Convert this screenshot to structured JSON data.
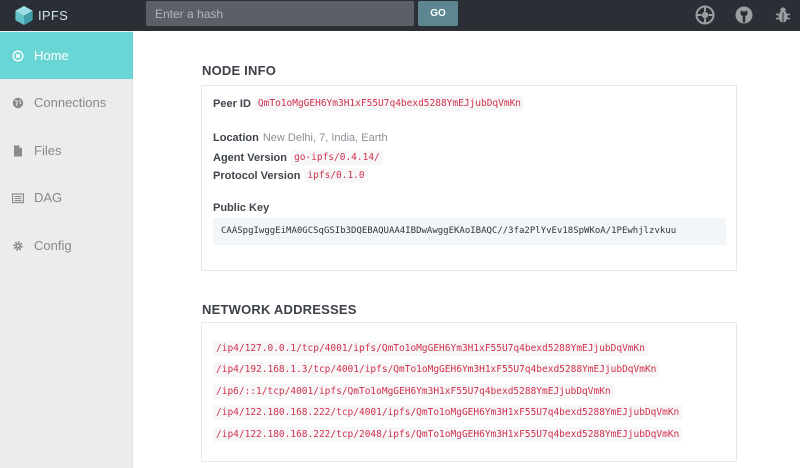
{
  "app": {
    "name": "IPFS"
  },
  "search": {
    "placeholder": "Enter a hash",
    "go_label": "GO"
  },
  "topbar_icons": [
    "settings-wheel-icon",
    "github-icon",
    "bug-icon"
  ],
  "sidebar": {
    "items": [
      {
        "label": "Home",
        "icon": "home-target-icon",
        "active": true
      },
      {
        "label": "Connections",
        "icon": "globe-icon",
        "active": false
      },
      {
        "label": "Files",
        "icon": "file-icon",
        "active": false
      },
      {
        "label": "DAG",
        "icon": "dag-list-icon",
        "active": false
      },
      {
        "label": "Config",
        "icon": "gear-icon",
        "active": false
      }
    ]
  },
  "node_info": {
    "title": "NODE INFO",
    "peer_id_label": "Peer ID",
    "peer_id": "QmTo1oMgGEH6Ym3H1xF55U7q4bexd5288YmEJjubDqVmKn",
    "location_label": "Location",
    "location": "New Delhi, 7, India, Earth",
    "agent_label": "Agent Version",
    "agent": "go-ipfs/0.4.14/",
    "protocol_label": "Protocol Version",
    "protocol": "ipfs/0.1.0",
    "public_key_label": "Public Key",
    "public_key": "CAASpgIwggEiMA0GCSqGSIb3DQEBAQUAA4IBDwAwggEKAoIBAQC//3fa2PlYvEv18SpWKoA/1PEwhjlzvkuu"
  },
  "network": {
    "title": "NETWORK ADDRESSES",
    "addresses": [
      "/ip4/127.0.0.1/tcp/4001/ipfs/QmTo1oMgGEH6Ym3H1xF55U7q4bexd5288YmEJjubDqVmKn",
      "/ip4/192.168.1.3/tcp/4001/ipfs/QmTo1oMgGEH6Ym3H1xF55U7q4bexd5288YmEJjubDqVmKn",
      "/ip6/::1/tcp/4001/ipfs/QmTo1oMgGEH6Ym3H1xF55U7q4bexd5288YmEJjubDqVmKn",
      "/ip4/122.180.168.222/tcp/4001/ipfs/QmTo1oMgGEH6Ym3H1xF55U7q4bexd5288YmEJjubDqVmKn",
      "/ip4/122.180.168.222/tcp/2048/ipfs/QmTo1oMgGEH6Ym3H1xF55U7q4bexd5288YmEJjubDqVmKn"
    ]
  },
  "colors": {
    "topbar": "#2b2e34",
    "accent": "#6ad5d5",
    "code_text": "#d0314f"
  }
}
